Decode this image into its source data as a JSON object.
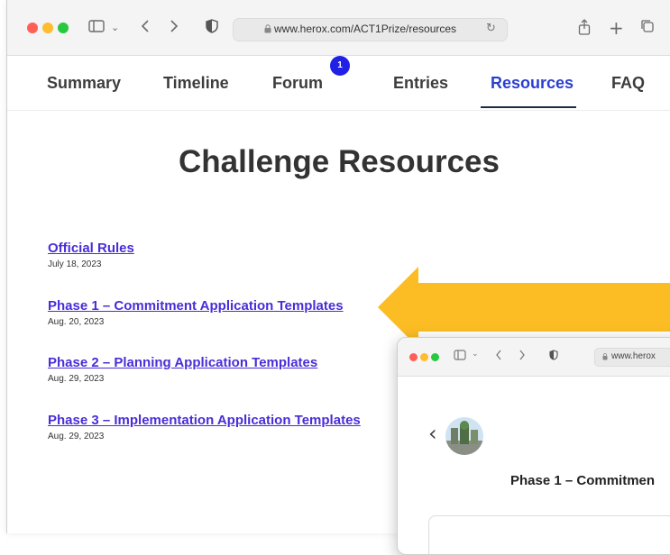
{
  "browser": {
    "url": "www.herox.com/ACT1Prize/resources"
  },
  "nav": {
    "tabs": [
      {
        "label": "Summary"
      },
      {
        "label": "Timeline"
      },
      {
        "label": "Forum"
      },
      {
        "label": "Entries"
      },
      {
        "label": "Resources"
      },
      {
        "label": "FAQ"
      }
    ],
    "active_tab": "Resources",
    "forum_badge": "1"
  },
  "page": {
    "heading": "Challenge Resources",
    "resources": [
      {
        "title": "Official Rules",
        "date": "July 18, 2023"
      },
      {
        "title": "Phase 1 – Commitment Application Templates",
        "date": "Aug. 20, 2023"
      },
      {
        "title": "Phase 2 – Planning Application Templates",
        "date": "Aug. 29, 2023"
      },
      {
        "title": "Phase 3 – Implementation Application Templates",
        "date": "Aug. 29, 2023"
      }
    ]
  },
  "overlay": {
    "url": "www.herox",
    "title": "Phase 1 – Commitmen"
  },
  "colors": {
    "link": "#4a2cd8",
    "active_tab": "#2a3fd1",
    "arrow": "#fbbd23",
    "badge": "#2020e6"
  }
}
